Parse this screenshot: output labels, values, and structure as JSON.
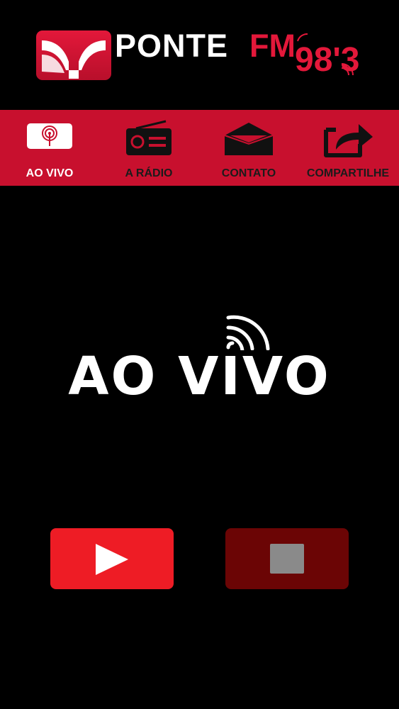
{
  "header": {
    "brand_ponte": "PONTE",
    "brand_fm": "FM",
    "brand_frequency": "98'3",
    "logo_icon": "ponte-logo-icon"
  },
  "nav": {
    "items": [
      {
        "label": "AO VIVO",
        "icon": "live-broadcast-icon",
        "active": true
      },
      {
        "label": "A RÁDIO",
        "icon": "radio-icon",
        "active": false
      },
      {
        "label": "CONTATO",
        "icon": "envelope-icon",
        "active": false
      },
      {
        "label": "COMPARTILHE",
        "icon": "share-icon",
        "active": false
      }
    ]
  },
  "main": {
    "heading": "AO VIVO",
    "heading_icon": "signal-waves-icon"
  },
  "controls": {
    "play_icon": "play-icon",
    "stop_icon": "stop-icon"
  },
  "colors": {
    "brand_red": "#c8102e",
    "play_red": "#ee1c25",
    "stop_dark_red": "#6b0505",
    "background": "#000000"
  }
}
